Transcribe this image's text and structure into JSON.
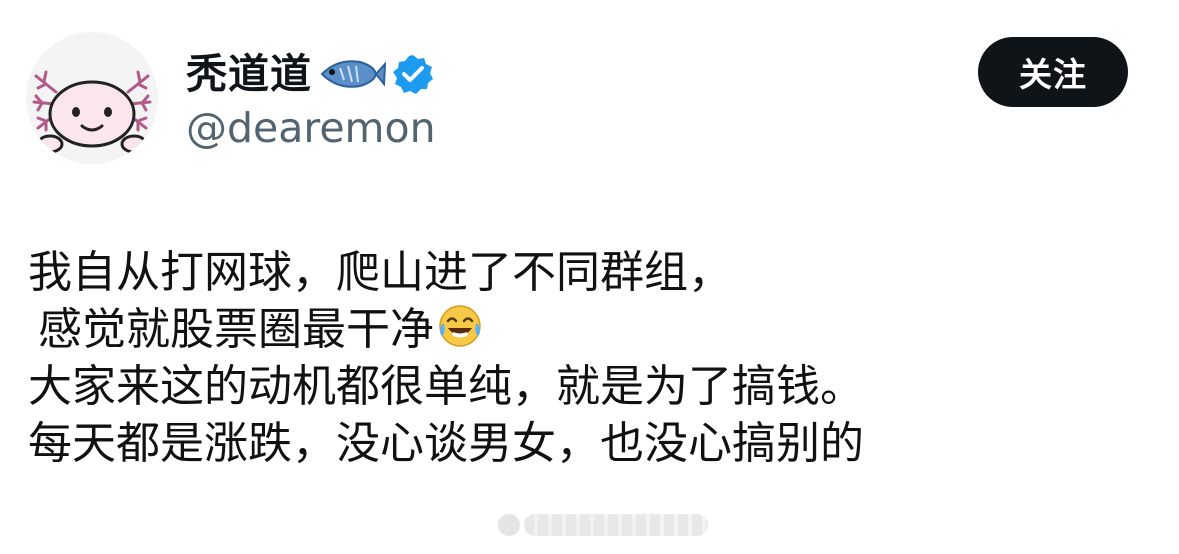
{
  "author": {
    "display_name": "秃道道",
    "handle": "@dearemon",
    "avatar_icon": "axolotl-avatar-icon",
    "name_emoji_icon": "fish-icon",
    "verified_icon": "verified-badge-icon",
    "verified_color": "#1d9bf0"
  },
  "actions": {
    "follow_label": "关注"
  },
  "tweet": {
    "lines": [
      "我自从打网球，爬山进了不同群组，",
      "感觉就股票圈最干净",
      "大家来这的动机都很单纯，就是为了搞钱。",
      "每天都是涨跌，没心谈男女，也没心搞别的"
    ],
    "line2_emoji_icon": "face-with-tears-of-joy-icon"
  },
  "colors": {
    "follow_button_bg": "#0f1419",
    "handle_text": "#536471",
    "body_text": "#111111"
  }
}
